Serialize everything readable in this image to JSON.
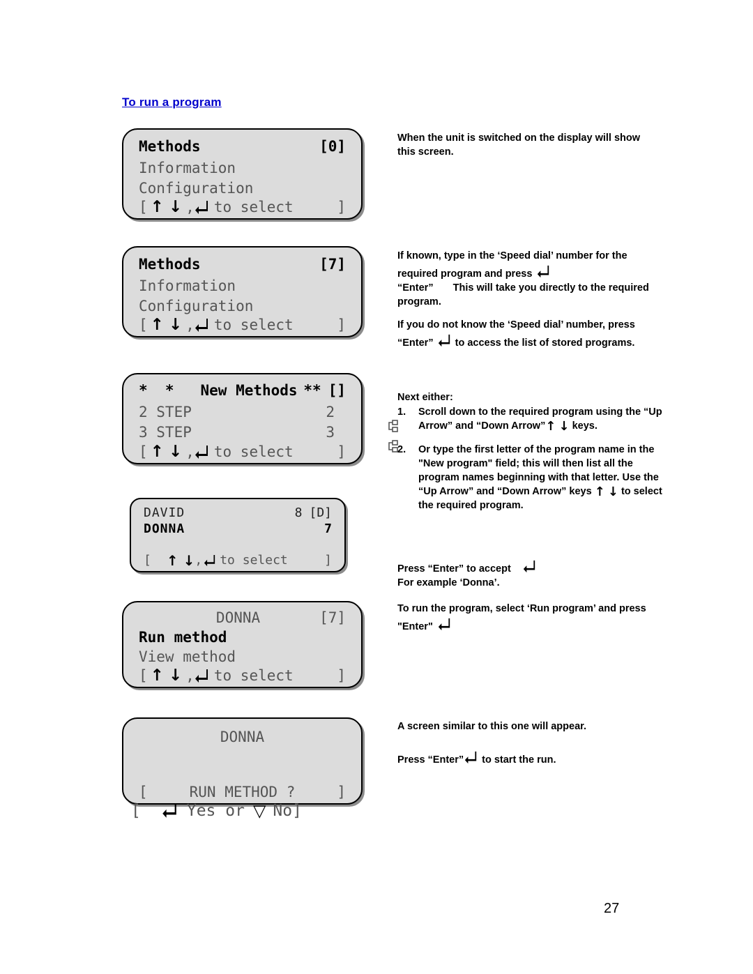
{
  "document": {
    "section_title": "To run a program",
    "page_number": "27"
  },
  "screens": [
    {
      "id": "methods-0",
      "line1_left": "Methods",
      "line1_right": "[0]",
      "line2": "Information",
      "line3": "Configuration",
      "hint_open": "[",
      "hint_up": "↑",
      "hint_down": "↓",
      "hint_comma": ",",
      "hint_enter_icon": "enter-key-icon",
      "hint_text": "to select",
      "hint_close": "]"
    },
    {
      "id": "methods-7",
      "line1_left": "Methods",
      "line1_right": "[7]",
      "line2": "Information",
      "line3": "Configuration",
      "hint_open": "[",
      "hint_up": "↑",
      "hint_down": "↓",
      "hint_comma": ",",
      "hint_enter_icon": "enter-key-icon",
      "hint_text": "to select",
      "hint_close": "]"
    },
    {
      "id": "new-methods",
      "line1_left": "*  *   New Methods",
      "line1_mid": "**",
      "line1_right": "[]",
      "row2_label": "2 STEP",
      "row2_value": "2",
      "row2_icon": "step-program-icon",
      "row3_label": "3 STEP",
      "row3_value": "3",
      "row3_icon": "step-program-icon",
      "hint_open": "[",
      "hint_up": "↑",
      "hint_down": "↓",
      "hint_comma": ",",
      "hint_enter_icon": "enter-key-icon",
      "hint_text": "to select",
      "hint_close": "]"
    },
    {
      "id": "program-list",
      "row1_label": "DAVID",
      "row1_value": "8",
      "row1_tag": "[D]",
      "row2_label": "DONNA",
      "row2_value": "7",
      "hint_open": "[",
      "hint_up": "↑",
      "hint_down": "↓",
      "hint_comma": ",",
      "hint_enter_icon": "enter-key-icon",
      "hint_text": "to select",
      "hint_close": "]"
    },
    {
      "id": "donna-menu",
      "line1_center": "DONNA",
      "line1_right": "[7]",
      "line2": "Run method",
      "line3": "View method",
      "hint_open": "[",
      "hint_up": "↑",
      "hint_down": "↓",
      "hint_comma": ",",
      "hint_enter_icon": "enter-key-icon",
      "hint_text": "to select",
      "hint_close": "]"
    },
    {
      "id": "donna-confirm",
      "line1_center": "DONNA",
      "prompt_open": "[",
      "prompt": "RUN METHOD ?",
      "prompt_close": "]",
      "confirm_open": "[",
      "confirm_enter_icon": "enter-key-icon",
      "confirm_yes": "Yes or",
      "confirm_no_icon": "down-triangle-icon",
      "confirm_no": "No",
      "confirm_close": "]"
    }
  ],
  "notes": {
    "startup": "When the unit is switched on the display will show this screen.",
    "speed_dial_known_a": "If known, type in the ‘Speed dial’ number for the required program and press",
    "speed_dial_known_b": "“Enter”",
    "speed_dial_known_c": "This will take you directly to the required program.",
    "speed_dial_unknown_a": "If you do not know the ‘Speed dial’ number, press “Enter”",
    "speed_dial_unknown_b": "to access the list of stored programs.",
    "next_either": "Next either:",
    "item1_num": "1.",
    "item1_a": "Scroll down to the required program using the “Up Arrow” and “Down Arrow”",
    "item1_b": "keys.",
    "item2_num": "2.",
    "item2_a": "Or type the first letter of the program name in the \"New program\" field; this will then list all the program names beginning with that letter. Use the “Up Arrow” and “Down Arrow” keys",
    "item2_b": "to select the required program.",
    "accept_a": "Press “Enter” to accept",
    "accept_b": "For example ‘Donna’.",
    "run_a": "To run the program, select ‘Run program’ and press \"Enter\"",
    "appear": "A screen similar to this one will appear.",
    "start_a": "Press “Enter”",
    "start_b": "to start the run."
  },
  "colors": {
    "link": "#0000cc",
    "lcd_bg": "#dcdcdc",
    "lcd_text_dim": "#5a5a5a",
    "lcd_text_sel": "#000000"
  }
}
